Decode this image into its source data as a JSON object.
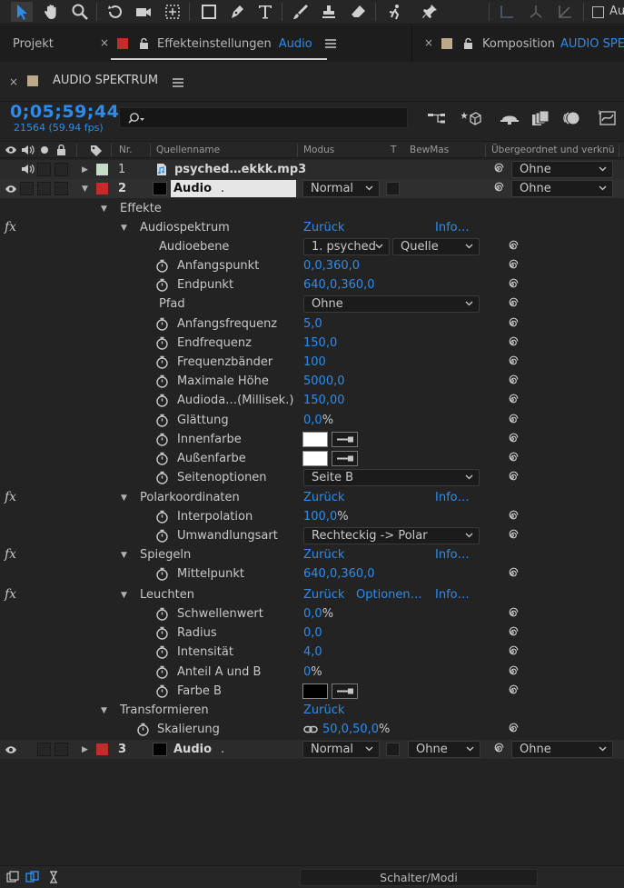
{
  "toolbar": {
    "partial_label": "Au"
  },
  "tabs": {
    "projekt": "Projekt",
    "effekt_prefix": "Effekteinstellungen",
    "effekt_name": "Audio",
    "komp_prefix": "Komposition",
    "komp_name": "AUDIO SPE",
    "effekt_swatch": "#c42b2b",
    "komp_swatch": "#bca98a"
  },
  "comp": {
    "title": "AUDIO SPEKTRUM",
    "swatch": "#bca98a"
  },
  "time": {
    "timecode": "0;05;59;44",
    "frames": "21564 (59.94 fps)"
  },
  "columns": {
    "nr": "Nr.",
    "source": "Quellenname",
    "mode": "Modus",
    "t": "T",
    "bewmas": "BewMas",
    "parent": "Übergeordnet und verknü"
  },
  "layers": [
    {
      "nr": "1",
      "name": "psyched…ekkk.mp3",
      "parent": "Ohne",
      "swatch": "#c6dcc6"
    },
    {
      "nr": "2",
      "name": "Audio",
      "name_suffix": ".",
      "mode": "Normal",
      "parent": "Ohne",
      "swatch": "#c42b2b"
    },
    {
      "nr": "3",
      "name": "Audio",
      "name_suffix": ".",
      "mode": "Normal",
      "bewmas": "Ohne",
      "parent": "Ohne",
      "swatch": "#c42b2b"
    }
  ],
  "effects": {
    "group": "Effekte",
    "audiospektrum": {
      "name": "Audiospektrum",
      "reset": "Zurück",
      "info": "Info…",
      "audioebene": {
        "label": "Audioebene",
        "layer": "1. psyched",
        "source": "Quelle"
      },
      "anfangspunkt": {
        "label": "Anfangspunkt",
        "value": "0,0,360,0"
      },
      "endpunkt": {
        "label": "Endpunkt",
        "value": "640,0,360,0"
      },
      "pfad": {
        "label": "Pfad",
        "value": "Ohne"
      },
      "anfangsfrequenz": {
        "label": "Anfangsfrequenz",
        "value": "5,0"
      },
      "endfrequenz": {
        "label": "Endfrequenz",
        "value": "150,0"
      },
      "frequenzbaender": {
        "label": "Frequenzbänder",
        "value": "100"
      },
      "maxhoehe": {
        "label": "Maximale Höhe",
        "value": "5000,0"
      },
      "audiodauer": {
        "label": "Audioda…(Millisek.)",
        "value": "150,00"
      },
      "glaettung": {
        "label": "Glättung",
        "value": "0,0",
        "unit": "%"
      },
      "innenfarbe": {
        "label": "Innenfarbe",
        "color": "#ffffff"
      },
      "aussenfarbe": {
        "label": "Außenfarbe",
        "color": "#ffffff"
      },
      "seitenoptionen": {
        "label": "Seitenoptionen",
        "value": "Seite B"
      }
    },
    "polar": {
      "name": "Polarkoordinaten",
      "reset": "Zurück",
      "info": "Info…",
      "interpolation": {
        "label": "Interpolation",
        "value": "100,0",
        "unit": "%"
      },
      "umwandlungsart": {
        "label": "Umwandlungsart",
        "value": "Rechteckig -> Polar"
      }
    },
    "spiegeln": {
      "name": "Spiegeln",
      "reset": "Zurück",
      "info": "Info…",
      "mittelpunkt": {
        "label": "Mittelpunkt",
        "value": "640,0,360,0"
      }
    },
    "leuchten": {
      "name": "Leuchten",
      "reset": "Zurück",
      "options": "Optionen…",
      "info": "Info…",
      "schwellenwert": {
        "label": "Schwellenwert",
        "value": "0,0",
        "unit": "%"
      },
      "radius": {
        "label": "Radius",
        "value": "0,0"
      },
      "intensitaet": {
        "label": "Intensität",
        "value": "4,0"
      },
      "anteil": {
        "label": "Anteil A und B",
        "value": "0",
        "unit": "%"
      },
      "farbe_b": {
        "label": "Farbe B",
        "color": "#000000"
      }
    }
  },
  "transform": {
    "name": "Transformieren",
    "reset": "Zurück",
    "skalierung": {
      "label": "Skalierung",
      "value": "50,0,50,0",
      "unit": "%"
    }
  },
  "bottom": {
    "toggle": "Schalter/Modi"
  },
  "colors": {
    "accent": "#2d8ceb",
    "bg": "#232323"
  }
}
